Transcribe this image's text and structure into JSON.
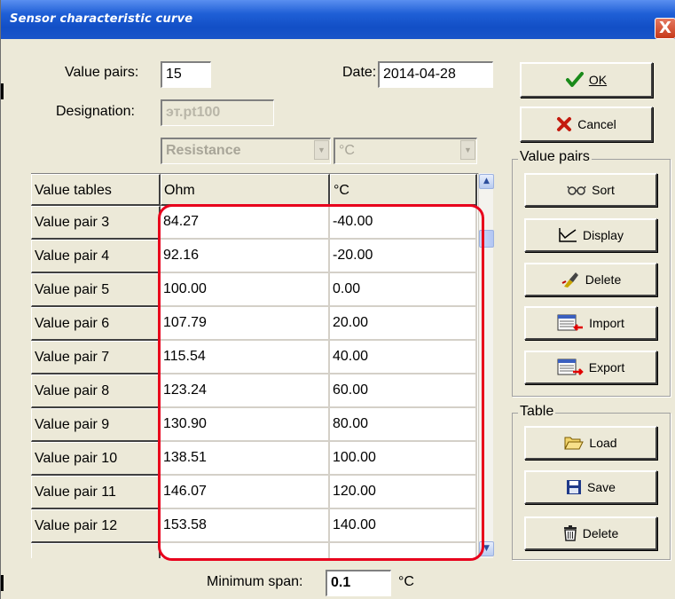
{
  "window": {
    "title": "Sensor characteristic curve",
    "close_label": "X"
  },
  "form": {
    "value_pairs_label": "Value pairs:",
    "value_pairs_count": "15",
    "date_label": "Date:",
    "date_value": "2014-04-28",
    "designation_label": "Designation:",
    "designation_value": "эт.pt100",
    "input_quantity": "Resistance",
    "output_unit": "°C",
    "min_span_label": "Minimum span:",
    "min_span_value": "0.1",
    "min_span_unit": "°C"
  },
  "buttons": {
    "ok": "OK",
    "cancel": "Cancel"
  },
  "value_pairs_group": {
    "title": "Value pairs",
    "sort": "Sort",
    "display": "Display",
    "delete": "Delete",
    "import": "Import",
    "export": "Export"
  },
  "table_group": {
    "title": "Table",
    "load": "Load",
    "save": "Save",
    "delete": "Delete"
  },
  "grid": {
    "header": [
      "Value tables",
      "Ohm",
      "°C"
    ],
    "rows": [
      {
        "label": "Value pair 3",
        "ohm": "84.27",
        "celsius": "-40.00"
      },
      {
        "label": "Value pair 4",
        "ohm": "92.16",
        "celsius": "-20.00"
      },
      {
        "label": "Value pair 5",
        "ohm": "100.00",
        "celsius": "0.00"
      },
      {
        "label": "Value pair 6",
        "ohm": "107.79",
        "celsius": "20.00"
      },
      {
        "label": "Value pair 7",
        "ohm": "115.54",
        "celsius": "40.00"
      },
      {
        "label": "Value pair 8",
        "ohm": "123.24",
        "celsius": "60.00"
      },
      {
        "label": "Value pair 9",
        "ohm": "130.90",
        "celsius": "80.00"
      },
      {
        "label": "Value pair 10",
        "ohm": "138.51",
        "celsius": "100.00"
      },
      {
        "label": "Value pair 11",
        "ohm": "146.07",
        "celsius": "120.00"
      },
      {
        "label": "Value pair 12",
        "ohm": "153.58",
        "celsius": "140.00"
      }
    ]
  },
  "colors": {
    "titlebar": "#124fc6",
    "dialog_bg": "#ece9d8",
    "highlight": "#e8001c"
  }
}
